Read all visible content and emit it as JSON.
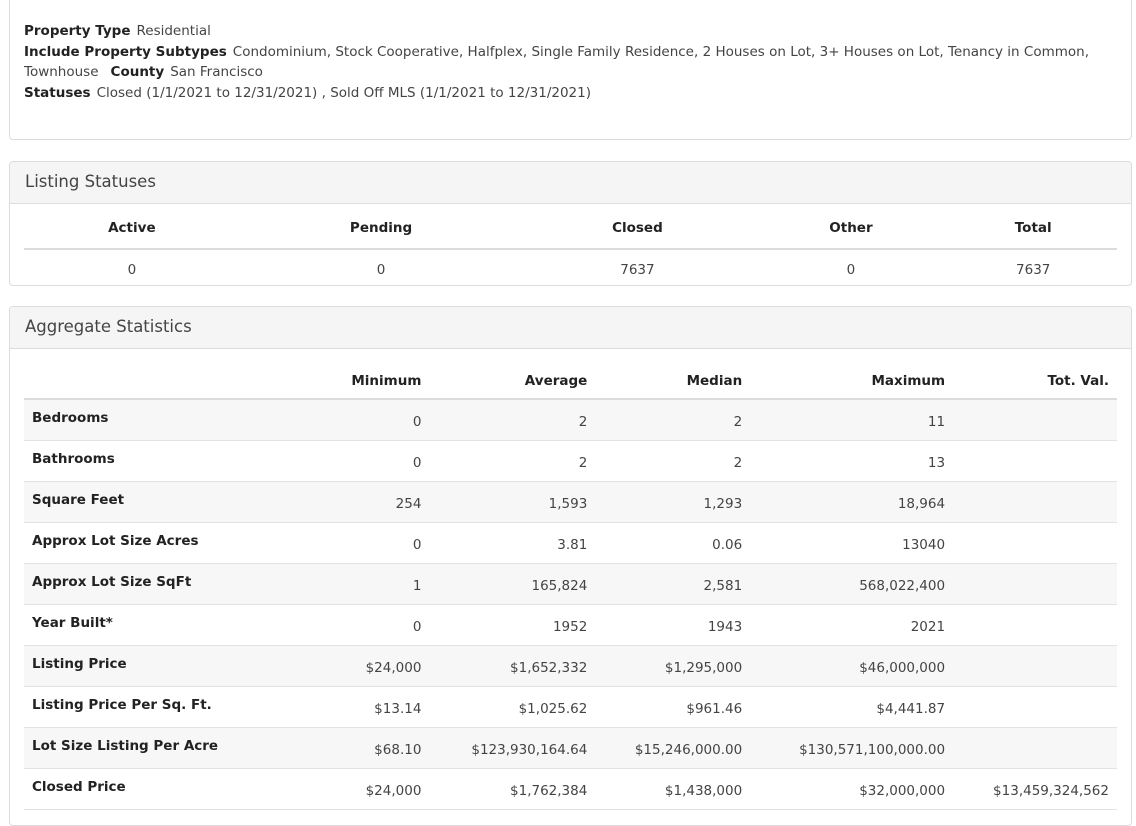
{
  "criteria": {
    "property_type_label": "Property Type",
    "property_type_value": "Residential",
    "subtypes_label": "Include Property Subtypes",
    "subtypes_value": "Condominium, Stock Cooperative, Halfplex, Single Family Residence, 2 Houses on Lot, 3+ Houses on Lot, Tenancy in Common, Townhouse",
    "county_label": "County",
    "county_value": "San Francisco",
    "statuses_label": "Statuses",
    "statuses_value": "Closed (1/1/2021 to 12/31/2021) , Sold Off MLS (1/1/2021 to 12/31/2021)"
  },
  "listing_statuses": {
    "title": "Listing Statuses",
    "headers": [
      "Active",
      "Pending",
      "Closed",
      "Other",
      "Total"
    ],
    "values": [
      "0",
      "0",
      "7637",
      "0",
      "7637"
    ]
  },
  "aggregate": {
    "title": "Aggregate Statistics",
    "headers": [
      "",
      "Minimum",
      "Average",
      "Median",
      "Maximum",
      "Tot. Val."
    ],
    "rows": [
      {
        "label": "Bedrooms",
        "cells": [
          "0",
          "2",
          "2",
          "11",
          ""
        ]
      },
      {
        "label": "Bathrooms",
        "cells": [
          "0",
          "2",
          "2",
          "13",
          ""
        ]
      },
      {
        "label": "Square Feet",
        "cells": [
          "254",
          "1,593",
          "1,293",
          "18,964",
          ""
        ]
      },
      {
        "label": "Approx Lot Size Acres",
        "cells": [
          "0",
          "3.81",
          "0.06",
          "13040",
          ""
        ]
      },
      {
        "label": "Approx Lot Size SqFt",
        "cells": [
          "1",
          "165,824",
          "2,581",
          "568,022,400",
          ""
        ]
      },
      {
        "label": "Year Built*",
        "cells": [
          "0",
          "1952",
          "1943",
          "2021",
          ""
        ]
      },
      {
        "label": "Listing Price",
        "cells": [
          "$24,000",
          "$1,652,332",
          "$1,295,000",
          "$46,000,000",
          ""
        ]
      },
      {
        "label": "Listing Price Per Sq. Ft.",
        "cells": [
          "$13.14",
          "$1,025.62",
          "$961.46",
          "$4,441.87",
          ""
        ]
      },
      {
        "label": "Lot Size Listing Per Acre",
        "cells": [
          "$68.10",
          "$123,930,164.64",
          "$15,246,000.00",
          "$130,571,100,000.00",
          ""
        ]
      },
      {
        "label": "Closed Price",
        "cells": [
          "$24,000",
          "$1,762,384",
          "$1,438,000",
          "$32,000,000",
          "$13,459,324,562"
        ]
      }
    ]
  }
}
